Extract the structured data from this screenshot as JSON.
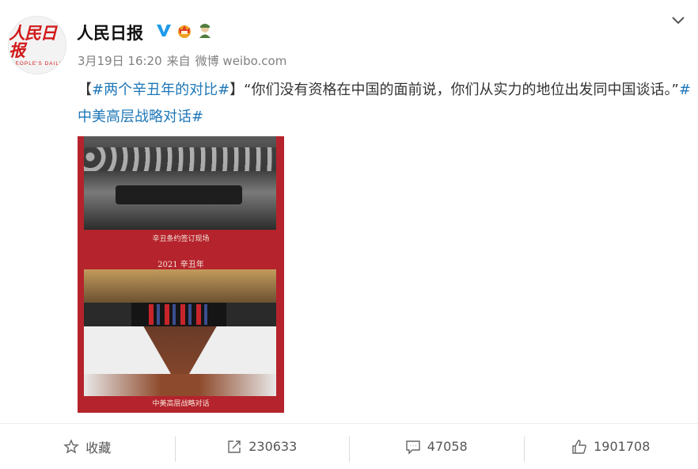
{
  "account": {
    "name": "人民日报",
    "avatar_logo_cn": "人民日报",
    "avatar_logo_en": "PEOPLE'S DAILY",
    "badges": [
      "verified-v-icon",
      "crown-badge-icon",
      "soldier-badge-icon"
    ]
  },
  "post": {
    "date": "3月19日 16:20",
    "source_prefix": "来自",
    "source": "微博 weibo.com",
    "bracket_open": "【",
    "topic1": "#两个辛丑年的对比#",
    "bracket_close": "】",
    "quote": "“你们没有资格在中国的面前说，你们从实力的地位出发同中国谈话。”",
    "topic2": "#中美高层战略对话#"
  },
  "image": {
    "caption1": "辛丑条约签订现场",
    "caption2": "2021 辛丑年",
    "caption3": "中美高层战略对话"
  },
  "actions": {
    "favorite_label": "收藏",
    "repost_count": "230633",
    "comment_count": "47058",
    "like_count": "1901708"
  },
  "colors": {
    "topic_link": "#1e77b8",
    "image_bg": "#b5232c",
    "verified": "#1e9bea"
  }
}
